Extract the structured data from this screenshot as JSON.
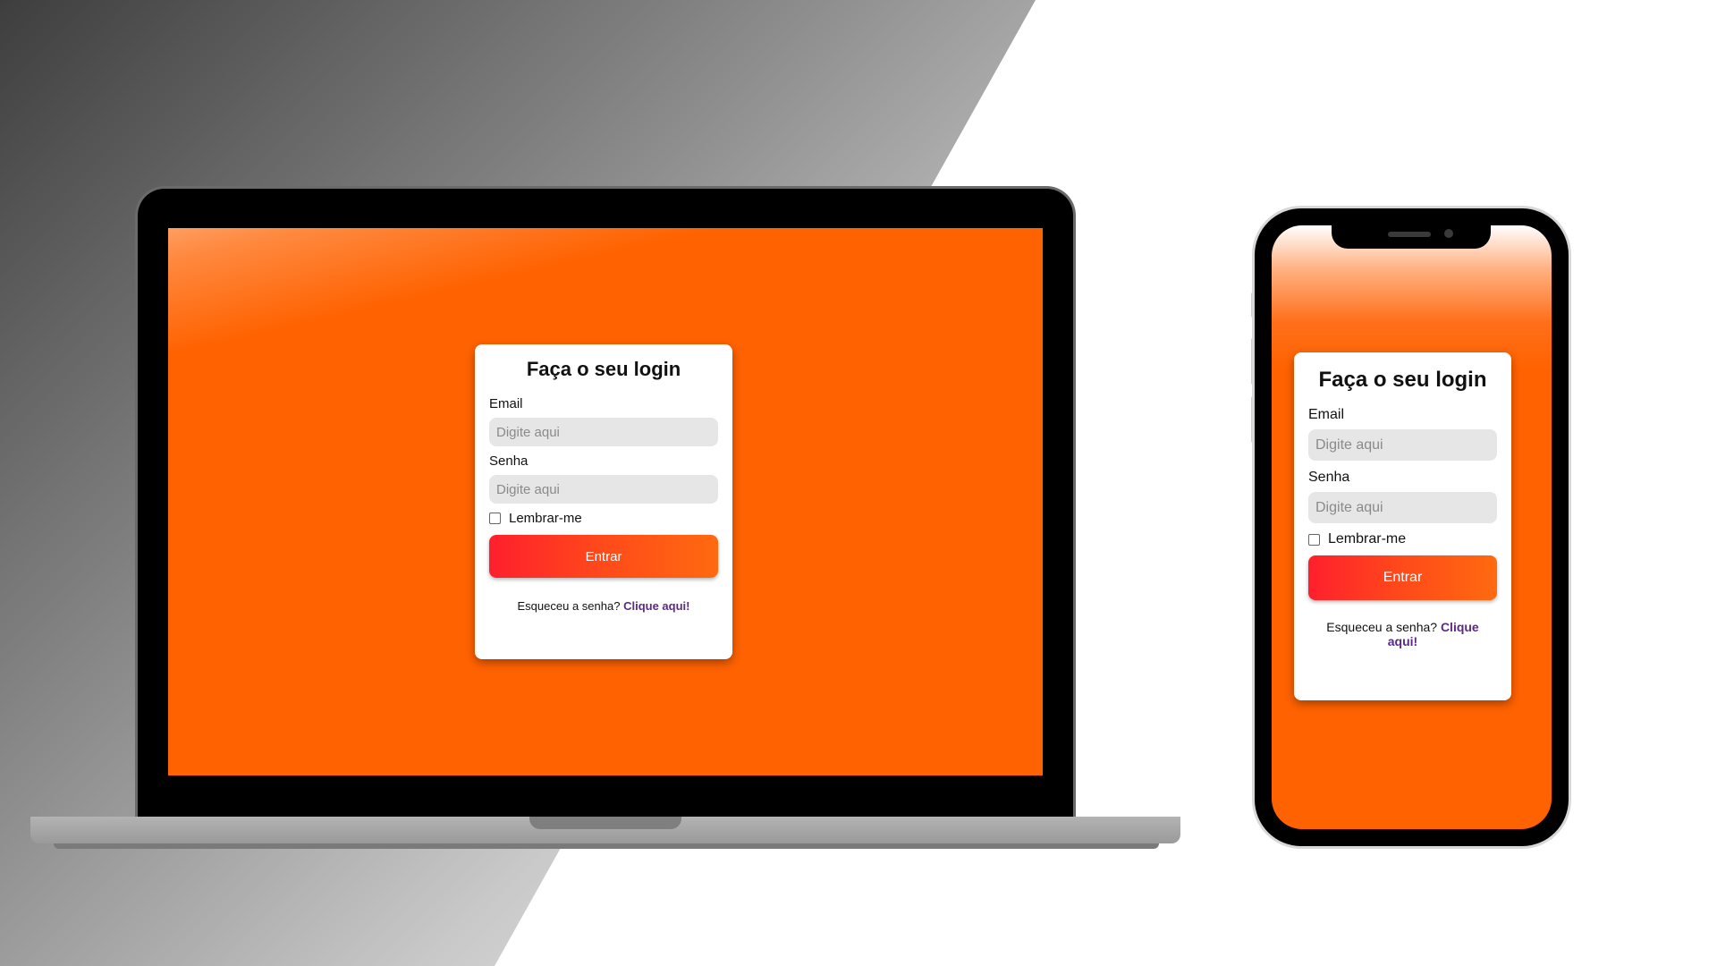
{
  "login": {
    "title": "Faça o seu login",
    "email_label": "Email",
    "email_placeholder": "Digite aqui",
    "email_value": "",
    "password_label": "Senha",
    "password_placeholder": "Digite aqui",
    "password_value": "",
    "remember_label": "Lembrar-me",
    "remember_checked": false,
    "submit_label": "Entrar",
    "forgot_text": "Esqueceu a senha?",
    "forgot_link": "Clique aqui!"
  },
  "colors": {
    "screen_background": "#ff6200",
    "button_gradient_start": "#ff1f2d",
    "button_gradient_end": "#ff6a0f",
    "link": "#5b2a86",
    "input_background": "#e6e6e6"
  }
}
